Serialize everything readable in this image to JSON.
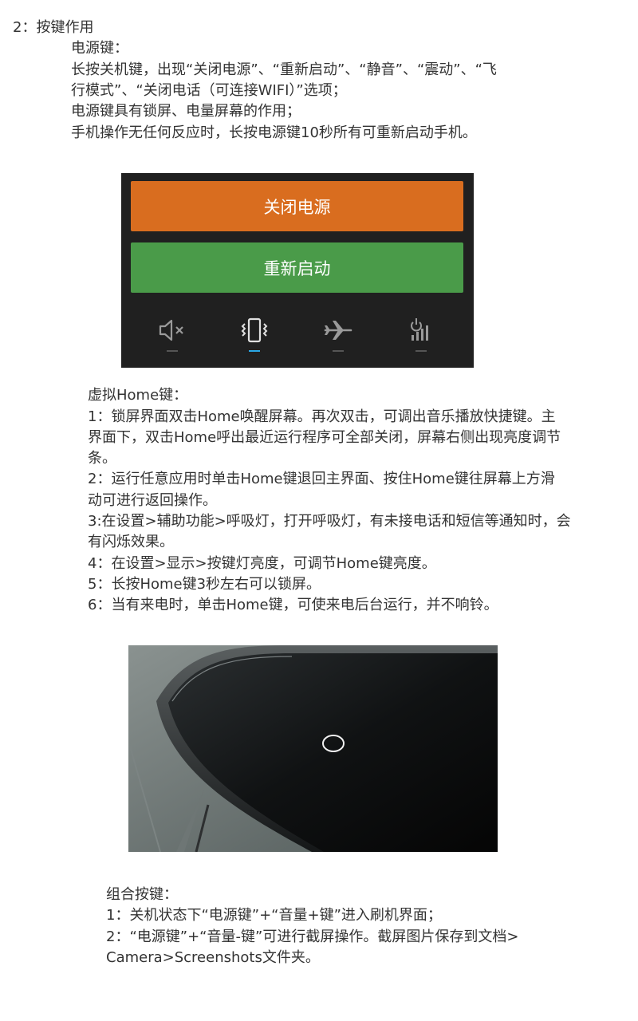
{
  "section_heading": "2：按键作用",
  "power_key": {
    "title": "电源键：",
    "lines": [
      "长按关机键，出现“关闭电源”、“重新启动”、“静音”、“震动”、“飞",
      "行模式”、“关闭电话（可连接WIFI）”选项；",
      "电源键具有锁屏、电量屏幕的作用；",
      "手机操作无任何反应时，长按电源键10秒所有可重新启动手机。"
    ]
  },
  "power_menu": {
    "buttons": [
      "关闭电源",
      "重新启动"
    ],
    "mode_icons": [
      "mute-icon",
      "vibrate-icon",
      "airplane-icon",
      "mobile-data-icon"
    ],
    "active_mode_index": 1,
    "colors": {
      "background": "#202020",
      "power_off": "#d96d1f",
      "restart": "#4a9b49",
      "active_indicator": "#2aa7e6"
    }
  },
  "virtual_home": {
    "title": "虚拟Home键：",
    "lines": [
      "1：锁屏界面双击Home唤醒屏幕。再次双击，可调出音乐播放快捷键。主",
      "界面下，双击Home呼出最近运行程序可全部关闭，屏幕右侧出现亮度调节",
      "条。",
      "2：运行任意应用时单击Home键退回主界面、按住Home键往屏幕上方滑",
      "动可进行返回操作。",
      "3:在设置>辅助功能>呼吸灯，打开呼吸灯，有未接电话和短信等通知时，会",
      "有闪烁效果。",
      "4：在设置>显示>按键灯亮度，可调节Home键亮度。",
      "5：长按Home键3秒左右可以锁屏。",
      "6：当有来电时，单击Home键，可使来电后台运行，并不响铃。"
    ]
  },
  "combo_keys": {
    "title": "组合按键：",
    "lines": [
      "1：关机状态下“电源键”+“音量+键”进入刷机界面；",
      "2：“电源键”+“音量-键”可进行截屏操作。截屏图片保存到文档>",
      "Camera>Screenshots文件夹。"
    ]
  }
}
